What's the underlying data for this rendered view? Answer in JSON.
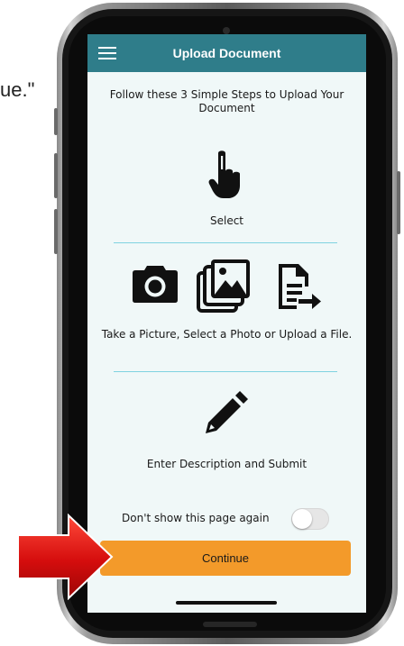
{
  "background": {
    "partial_text": "ue.\""
  },
  "header": {
    "title": "Upload Document",
    "menu_icon": "hamburger-menu-icon",
    "color": "#2f7d8a"
  },
  "intro_text": "Follow these 3 Simple Steps to Upload Your Document",
  "steps": [
    {
      "icons": [
        "hand-pointer-icon"
      ],
      "label": "Select"
    },
    {
      "icons": [
        "camera-icon",
        "photo-gallery-icon",
        "upload-file-icon"
      ],
      "label": "Take a Picture, Select a Photo or Upload a File."
    },
    {
      "icons": [
        "pencil-icon"
      ],
      "label": "Enter Description and Submit"
    }
  ],
  "toggle": {
    "label": "Don't show this page again",
    "state": "off"
  },
  "continue_button": {
    "label": "Continue",
    "color": "#f39a2a"
  },
  "annotation": {
    "arrow_icon": "red-arrow-icon",
    "color": "#e01212"
  },
  "colors": {
    "screen_bg": "#f0f8f8",
    "divider": "#7fd3e0"
  }
}
